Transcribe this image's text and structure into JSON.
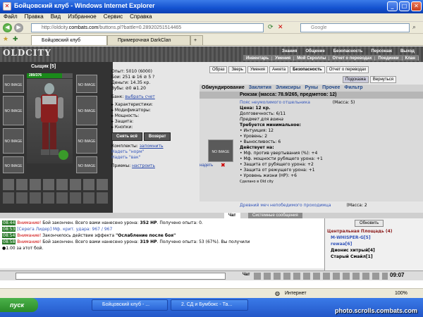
{
  "window": {
    "title": "Бойцовский клуб - Windows Internet Explorer"
  },
  "menu": [
    "Файл",
    "Правка",
    "Вид",
    "Избранное",
    "Сервис",
    "Справка"
  ],
  "address": {
    "prefix": "http://oldcity.",
    "domain": "combats.com",
    "path": "/buttons.pl?battle=0.28920251514465",
    "search_placeholder": "Google"
  },
  "tabs": [
    {
      "label": "Бойцовский клуб"
    },
    {
      "label": "Примерочная DarkClan"
    }
  ],
  "game": {
    "logo": "OLDCITY",
    "topnav": [
      "Знания",
      "Общение",
      "Безопасность",
      "Персонаж",
      "Выход"
    ],
    "subnav": [
      "Инвентарь",
      "Умения",
      "Мой Скроллы",
      "Отчет о переводах",
      "Поединки",
      "Клан"
    ],
    "character": {
      "name": "Сыщик",
      "level": "[5]",
      "hp": "289/376",
      "hp_fraction": 0.77,
      "noimage": "NO IMAGE",
      "buttons": {
        "undress": "Снять всё",
        "back": "Возврат"
      }
    },
    "stats": {
      "exp": "Опыт: 5010 (6000)",
      "wins": "Бои: 251 ⊕ 16 ⊘ 5 ?",
      "money": "Деньги: 14.35 кр.",
      "teeth": "Зубы: ⊘0 ⊕1.20",
      "bank_label": "Банк:",
      "bank_link": "выбрать счет",
      "sections": [
        "Характеристики:",
        "Модификаторы:",
        "Мощность:",
        "Защита:",
        "Кнопки:"
      ],
      "sets_label": "Комплекты:",
      "remember": "запомнить",
      "set1": "Надеть \"норм\"",
      "set2": "Надеть \"вак\"",
      "techniques_label": "Приемы:",
      "configure": "настроить"
    },
    "right_tabs": [
      "Образ",
      "Зверь",
      "Умения",
      "Анкета",
      "Безопасность",
      "Отчет о переводах"
    ],
    "right_tabs2": [
      "Подсказка",
      "Вернуться"
    ],
    "categories": [
      "Обмундирование",
      "Заклятия",
      "Эликсиры",
      "Руны",
      "Прочее",
      "Фильтр"
    ],
    "backpack": "Рюкзак (масса: 78.9/265, предметов: 12)",
    "item1": {
      "name": "Пояс неумолимого отшельника",
      "mass": "(Масса: 5)",
      "price": "Цена: 12 кр.",
      "durability": "Долговечность: 6/11",
      "purpose": "Предмет для воина",
      "req_title": "Требуется минимальное:",
      "req": [
        "• Интуиция: 12",
        "• Уровень: 2",
        "• Выносливость: 6"
      ],
      "act_title": "Действует на:",
      "act": [
        "• Мф. против увертывания (%): +4",
        "• Мф. мощности рубящего урона: +1",
        "• Защита от рубящего урона: +2",
        "• Защита от режущего урона: +1",
        "• Уровень жизни (HP): +6"
      ],
      "made": "Сделано в Old city",
      "wear": "надеть"
    },
    "item2": {
      "name": "Древний меч непобедимого проходимца",
      "mass": "(Масса: 2"
    },
    "chat_tabs": {
      "chat": "Чат",
      "system": "Системные сообщения"
    },
    "chat": [
      {
        "time": "08:44",
        "warn": "Внимание!",
        "text": " Бой закончен. Всего вами нанесено урона: ",
        "bold": "352 HP",
        "tail": ". Получено опыта: 0."
      },
      {
        "time": "08:53",
        "warn": "[Серега Лидер]",
        "text": " Мф. крит. удара: 967 / 967",
        "bold": "",
        "tail": ""
      },
      {
        "time": "08:54",
        "warn": "Внимание!",
        "text": " Закончилось действие эффекта ",
        "bold": "\"Ослабление после боя\"",
        "tail": ""
      },
      {
        "time": "08:58",
        "warn": "Внимание!",
        "text": " Бой закончен. Всего вами нанесено урона: ",
        "bold": "319 HP",
        "tail": ". Получено опыта: 53 (67%). Вы получили"
      },
      {
        "time": "",
        "warn": "",
        "text": "●1.00 за этот бой.",
        "bold": "",
        "tail": ""
      }
    ],
    "room": {
      "refresh": "Обновить",
      "title": "Центральная Площадь (4)",
      "users": [
        "M-WHISPER-G[5]",
        "rewaa[6]",
        "Дионис хитрый[4]",
        "Старый Смайл[1]"
      ],
      "clock": "09:07"
    }
  },
  "status": {
    "text": "",
    "zone": "Интернет",
    "zoom": "100%"
  },
  "taskbar": {
    "start": "пуск",
    "items": [
      "Бойцовский клуб - ...",
      "2. СД и Бумбокс - Та..."
    ],
    "watermark": "photo.scrolls.combats.com"
  }
}
